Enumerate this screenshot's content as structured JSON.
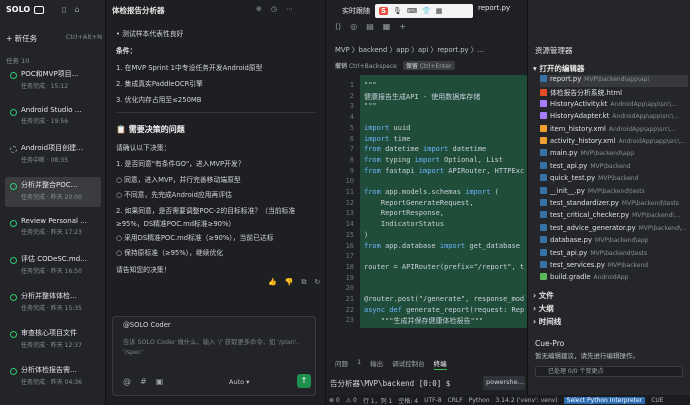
{
  "sidebar": {
    "brand": "SOLO",
    "new_task": "新任务",
    "new_task_shortcut": "Ctrl+Alt+N",
    "tasks_header": "任务",
    "tasks_count": "10",
    "tasks": [
      {
        "title": "POC和MVP项目…",
        "status": "任务完成 · 15:12",
        "state": "done"
      },
      {
        "title": "Android Studio …",
        "status": "任务完成 · 19:56",
        "state": "done"
      },
      {
        "title": "Android项目创建…",
        "status": "任务中断 · 08:35",
        "state": "run"
      },
      {
        "title": "分析并整合POC…",
        "status": "任务完成 · 昨天 20:00",
        "state": "done"
      },
      {
        "title": "Review Personal …",
        "status": "任务完成 · 昨天 17:23",
        "state": "done"
      },
      {
        "title": "评估 CODeSC.md…",
        "status": "任务完成 · 昨天 16:50",
        "state": "done"
      },
      {
        "title": "分析并整体体检…",
        "status": "任务完成 · 昨天 15:35",
        "state": "done"
      },
      {
        "title": "审查核心项目文件",
        "status": "任务完成 · 昨天 12:37",
        "state": "done"
      },
      {
        "title": "分析体检报告需…",
        "status": "任务完成 · 昨天 04:36",
        "state": "done"
      }
    ]
  },
  "chat": {
    "title": "体检报告分析器",
    "lines": [
      {
        "text": "• 测试样本代表性良好",
        "cls": ""
      },
      {
        "text": "条件：",
        "cls": "b"
      },
      {
        "text": "1. 在MVP Sprint 1中专设任务开发Android原型",
        "cls": ""
      },
      {
        "text": "2. 集成真实PaddleOCR引擎",
        "cls": ""
      },
      {
        "text": "3. 优化内存占用至≤250MB",
        "cls": ""
      },
      {
        "text": "📋 需要决策的问题",
        "cls": "h"
      },
      {
        "text": "请确认以下决策：",
        "cls": ""
      },
      {
        "text": "1. 是否同意\"有条件GO\"，进入MVP开发？",
        "cls": ""
      },
      {
        "text": "   ○ 同意，进入MVP，并行完善移动端原型",
        "cls": ""
      },
      {
        "text": "   ○ 不同意，先完成Android应用再评估",
        "cls": ""
      },
      {
        "text": "2. 如果同意，是否需要调整POC-2的目标标准？（当前标准",
        "cls": ""
      },
      {
        "text": "   ≥95%，DS精准POC.md标准≥90%）",
        "cls": ""
      },
      {
        "text": "   ○ 采用DS精准POC.md标准（≥90%），当前已达标",
        "cls": ""
      },
      {
        "text": "   ○ 保持原标准（≥95%），继续优化",
        "cls": ""
      },
      {
        "text": "请告知您的决策！",
        "cls": ""
      }
    ],
    "agent_label": "@SOLO Coder",
    "input_placeholder": "告诉 SOLO Coder 做什么，输入 '/' 获取更多命令，如 '/plan', '/spec'",
    "mode": "Auto"
  },
  "editor": {
    "window_label": "实时跟随",
    "tab_file": "report.py",
    "breadcrumb": "MVP 〉backend 〉app 〉api 〉report.py 〉...",
    "reject_label": "撤销",
    "reject_key": "Ctrl+Backspace",
    "accept_label": "保留",
    "accept_key": "Ctrl+Enter",
    "code_lines": [
      {
        "n": "1",
        "html": "\"\"\""
      },
      {
        "n": "2",
        "html": "健康报告生成API - 使用数据库存储"
      },
      {
        "n": "3",
        "html": "\"\"\""
      },
      {
        "n": "4",
        "html": ""
      },
      {
        "n": "5",
        "html": "import uuid"
      },
      {
        "n": "6",
        "html": "import time"
      },
      {
        "n": "7",
        "html": "from datetime import datetime"
      },
      {
        "n": "8",
        "html": "from typing import Optional, List"
      },
      {
        "n": "9",
        "html": "from fastapi import APIRouter, HTTPExc"
      },
      {
        "n": "10",
        "html": ""
      },
      {
        "n": "11",
        "html": "from app.models.schemas import ("
      },
      {
        "n": "12",
        "html": "    ReportGenerateRequest,"
      },
      {
        "n": "13",
        "html": "    ReportResponse,"
      },
      {
        "n": "14",
        "html": "    IndicatorStatus"
      },
      {
        "n": "15",
        "html": ")"
      },
      {
        "n": "16",
        "html": "from app.database import get_database"
      },
      {
        "n": "17",
        "html": ""
      },
      {
        "n": "18",
        "html": "router = APIRouter(prefix=\"/report\", t"
      },
      {
        "n": "19",
        "html": ""
      },
      {
        "n": "20",
        "html": ""
      },
      {
        "n": "21",
        "html": "@router.post(\"/generate\", response_mod"
      },
      {
        "n": "22",
        "html": "async def generate_report(request: Rep"
      },
      {
        "n": "23",
        "html": "    \"\"\"生成并保存健康体检报告\"\"\""
      }
    ],
    "panel_tabs": [
      "问题",
      "1",
      "输出",
      "调试控制台",
      "终端"
    ],
    "terminal_text": "告分析器\\MVP\\backend [0:0] $",
    "terminal_shell": "powershe…"
  },
  "explorer": {
    "title": "资源管理器",
    "open_editors": "打开的编辑器",
    "files": [
      {
        "name": "report.py",
        "path": "MVP\\backend\\app\\api",
        "color": "#3572A5",
        "sel": true
      },
      {
        "name": "体检报告分析系统.html",
        "path": "",
        "color": "#e44d26",
        "sel": false
      },
      {
        "name": "HistoryActivity.kt",
        "path": "AndroidApp\\app\\src\\...",
        "color": "#a97bff",
        "sel": false
      },
      {
        "name": "HistoryAdapter.kt",
        "path": "AndroidApp\\app\\src\\...",
        "color": "#a97bff",
        "sel": false
      },
      {
        "name": "item_history.xml",
        "path": "AndroidApp\\app\\src\\...",
        "color": "#f0a030",
        "sel": false
      },
      {
        "name": "activity_history.xml",
        "path": "AndroidApp\\app\\src\\...",
        "color": "#f0a030",
        "sel": false
      },
      {
        "name": "main.py",
        "path": "MVP\\backend\\app",
        "color": "#3572A5",
        "sel": false
      },
      {
        "name": "test_api.py",
        "path": "MVP\\backend",
        "color": "#3572A5",
        "sel": false
      },
      {
        "name": "quick_test.py",
        "path": "MVP\\backend",
        "color": "#3572A5",
        "sel": false
      },
      {
        "name": "__init__.py",
        "path": "MVP\\backend\\tests",
        "color": "#3572A5",
        "sel": false
      },
      {
        "name": "test_standardizer.py",
        "path": "MVP\\backend\\tests",
        "color": "#3572A5",
        "sel": false
      },
      {
        "name": "test_critical_checker.py",
        "path": "MVP\\backend\\...",
        "color": "#3572A5",
        "sel": false
      },
      {
        "name": "test_advice_generator.py",
        "path": "MVP\\backend\\...",
        "color": "#3572A5",
        "sel": false
      },
      {
        "name": "database.py",
        "path": "MVP\\backend\\app",
        "color": "#3572A5",
        "sel": false
      },
      {
        "name": "test_api.py",
        "path": "MVP\\backend\\tests",
        "color": "#3572A5",
        "sel": false
      },
      {
        "name": "test_services.py",
        "path": "MVP\\backend",
        "color": "#3572A5",
        "sel": false
      },
      {
        "name": "build.gradle",
        "path": "AndroidApp",
        "color": "#5bb85b",
        "sel": false
      }
    ],
    "sections": [
      "文件",
      "大纲",
      "时间线"
    ],
    "cue_title": "Cue-Pro",
    "cue_desc": "暂无编辑建议，请先进行编辑操作。",
    "progress": "已处理 0/0 个变更点"
  },
  "status": {
    "errors": "⊗ 0",
    "warnings": "⚠ 0",
    "ln": "行 1，列 1",
    "spaces": "空格: 4",
    "encoding": "UTF-8",
    "eol": "CRLF",
    "lang": "Python",
    "version": "3.14.2 ('venv': venv)",
    "interpreter": "Select Python Interpreter",
    "cue": "CUE"
  }
}
